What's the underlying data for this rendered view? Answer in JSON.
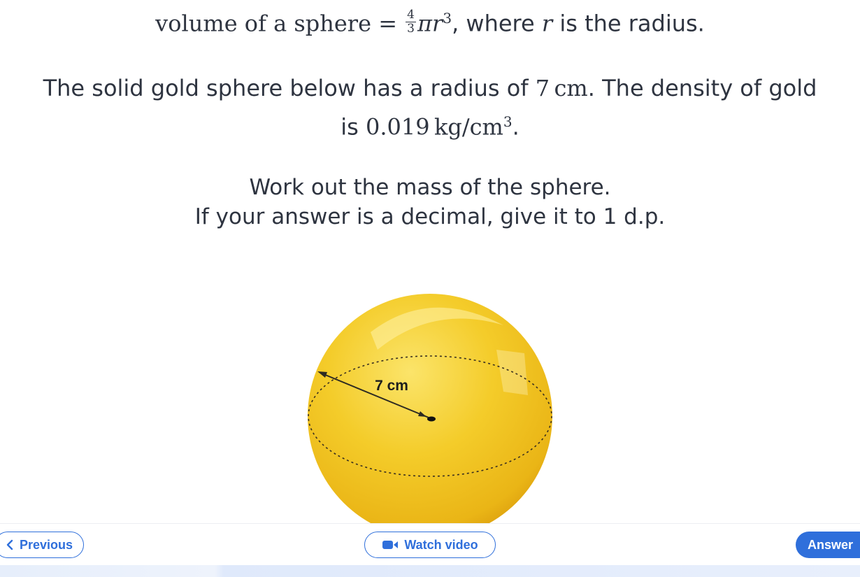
{
  "formula": {
    "lhs": "volume of a sphere",
    "equals": "=",
    "frac_num": "4",
    "frac_den": "3",
    "pi": "π",
    "r": "r",
    "exp": "3",
    "rest": ", where ",
    "r_var": "r",
    "tail": " is the radius."
  },
  "given": {
    "line1_prefix": "The solid gold sphere below has a radius of ",
    "radius_value": "7",
    "radius_unit": "cm",
    "line1_suffix": ". The density of gold",
    "line2_prefix": "is ",
    "density_value": "0.019",
    "density_unit": "kg/cm",
    "density_exp": "3",
    "line2_suffix": "."
  },
  "task": {
    "line1": "Work out the mass of the sphere.",
    "line2": "If your answer is a decimal, give it to 1 d.p."
  },
  "figure": {
    "radius_label": "7 cm",
    "sphere_color": "#f2c21b",
    "sphere_shadow_color": "#e0a30e"
  },
  "footer": {
    "previous_label": "Previous",
    "watch_video_label": "Watch video",
    "answer_label": "Answer"
  },
  "colors": {
    "accent": "#2f6fdb",
    "text": "#2e3440"
  }
}
